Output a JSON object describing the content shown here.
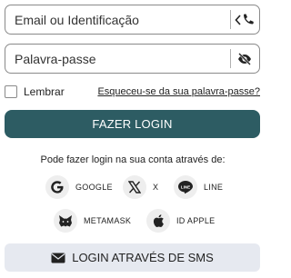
{
  "email_field": {
    "placeholder": "Email ou Identificação"
  },
  "password_field": {
    "placeholder": "Palavra-passe"
  },
  "remember": {
    "label": "Lembrar",
    "checked": false
  },
  "forgot_link": "Esqueceu-se da sua palavra-passe?",
  "login_button": "FAZER LOGIN",
  "alt_login_text": "Pode fazer login na sua conta através de:",
  "providers": [
    {
      "label": "GOOGLE",
      "icon": "google-icon"
    },
    {
      "label": "X",
      "icon": "x-icon"
    },
    {
      "label": "LINE",
      "icon": "line-icon"
    },
    {
      "label": "METAMASK",
      "icon": "metamask-icon"
    },
    {
      "label": "ID APPLE",
      "icon": "apple-icon"
    }
  ],
  "sms_button": "LOGIN ATRAVÉS DE SMS",
  "colors": {
    "primary": "#2d5c63",
    "sms_bg": "#e6e9f0",
    "provider_bg": "#eeeeee"
  }
}
